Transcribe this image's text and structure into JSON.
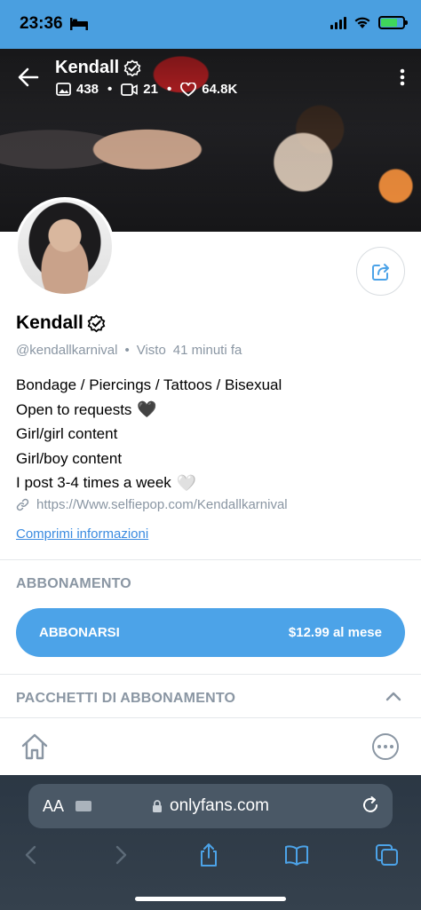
{
  "status_bar": {
    "time": "23:36"
  },
  "profile": {
    "name": "Kendall",
    "stats": {
      "photos": "438",
      "videos": "21",
      "likes": "64.8K"
    },
    "handle": "@kendallkarnival",
    "last_seen_label": "Visto",
    "last_seen_value": "41 minuti fa",
    "bio": [
      "Bondage / Piercings / Tattoos / Bisexual",
      "Open to requests",
      "Girl/girl content",
      "Girl/boy content",
      "I post 3-4 times a week"
    ],
    "link": "https://Www.selfiepop.com/Kendallkarnival",
    "collapse_label": "Comprimi informazioni"
  },
  "subscription": {
    "section_label": "ABBONAMENTO",
    "button_label": "ABBONARSI",
    "price": "$12.99 al mese",
    "bundles_label": "PACCHETTI DI ABBONAMENTO"
  },
  "browser": {
    "aa": "AA",
    "domain": "onlyfans.com"
  },
  "colors": {
    "accent": "#4ca3e8",
    "status_bar": "#4a9fe0",
    "muted": "#8a96a3"
  },
  "icons": [
    "back-arrow-icon",
    "verified-icon",
    "photo-icon",
    "video-icon",
    "heart-icon",
    "more-icon",
    "share-icon",
    "link-icon",
    "chevron-up-icon",
    "home-icon",
    "more-circle-icon",
    "lock-icon",
    "reload-icon",
    "browser-back-icon",
    "browser-forward-icon",
    "share-sheet-icon",
    "bookmarks-icon",
    "tabs-icon"
  ]
}
